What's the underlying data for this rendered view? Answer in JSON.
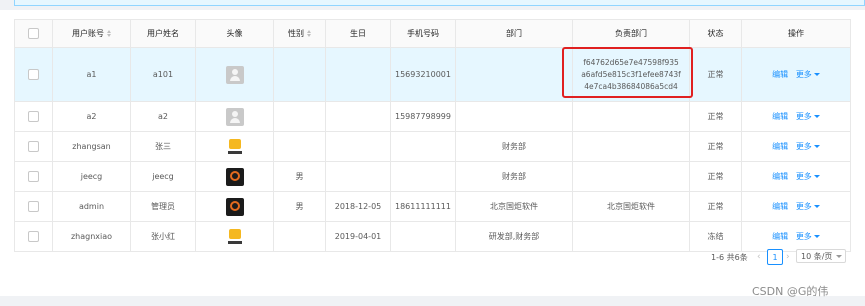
{
  "columns": {
    "username": "用户账号",
    "realname": "用户姓名",
    "avatar": "头像",
    "sex": "性别",
    "birthday": "生日",
    "phone": "手机号码",
    "dept": "部门",
    "charge_dept": "负责部门",
    "status": "状态",
    "action": "操作"
  },
  "rows": [
    {
      "username": "a1",
      "realname": "a101",
      "avatar": "default-user-icon",
      "sex": "",
      "birthday": "",
      "phone": "15693210001",
      "dept": "",
      "charge_dept": "f64762d65e7e47598f935a6afd5e815c3f1efee8743f4e7ca4b38684086a5cd4",
      "status": "正常",
      "edit": "编辑",
      "more": "更多"
    },
    {
      "username": "a2",
      "realname": "a2",
      "avatar": "default-user-icon",
      "sex": "",
      "birthday": "",
      "phone": "15987798999",
      "dept": "",
      "charge_dept": "",
      "status": "正常",
      "edit": "编辑",
      "more": "更多"
    },
    {
      "username": "zhangsan",
      "realname": "张三",
      "avatar": "yellow-logo-icon",
      "sex": "",
      "birthday": "",
      "phone": "",
      "dept": "财务部",
      "charge_dept": "",
      "status": "正常",
      "edit": "编辑",
      "more": "更多"
    },
    {
      "username": "jeecg",
      "realname": "jeecg",
      "avatar": "dark-logo-icon",
      "sex": "男",
      "birthday": "",
      "phone": "",
      "dept": "财务部",
      "charge_dept": "",
      "status": "正常",
      "edit": "编辑",
      "more": "更多"
    },
    {
      "username": "admin",
      "realname": "管理员",
      "avatar": "dark-logo-icon",
      "sex": "男",
      "birthday": "2018-12-05",
      "phone": "18611111111",
      "dept": "北京国炬软件",
      "charge_dept": "北京国炬软件",
      "status": "正常",
      "edit": "编辑",
      "more": "更多"
    },
    {
      "username": "zhagnxiao",
      "realname": "张小红",
      "avatar": "yellow-logo-icon",
      "sex": "",
      "birthday": "2019-04-01",
      "phone": "",
      "dept": "研发部,财务部",
      "charge_dept": "",
      "status": "冻结",
      "edit": "编辑",
      "more": "更多"
    }
  ],
  "pagination": {
    "total_text": "1-6 共6条",
    "prev": "‹",
    "current_page": "1",
    "next": "›",
    "page_size": "10 条/页"
  },
  "watermark": "CSDN @G的伟",
  "colors": {
    "accent": "#1890ff",
    "highlight_row": "#e6f7ff",
    "highlight_box": "#e02020"
  }
}
